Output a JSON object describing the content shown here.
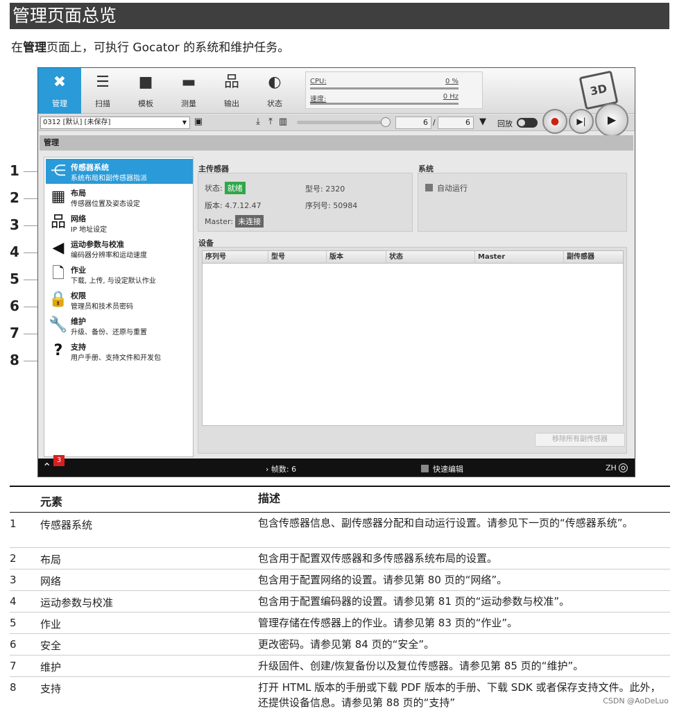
{
  "doc": {
    "title": "管理页面总览",
    "intro_pre": "在",
    "intro_bold": "管理",
    "intro_post": "页面上，可执行 Gocator 的系统和维护任务。"
  },
  "callouts": [
    "1",
    "2",
    "3",
    "4",
    "5",
    "6",
    "7",
    "8"
  ],
  "app": {
    "toolbar": [
      {
        "label": "管理",
        "icon": "tools-icon",
        "glyph": "✖"
      },
      {
        "label": "扫描",
        "icon": "scan-icon",
        "glyph": "☰"
      },
      {
        "label": "模板",
        "icon": "cubes-icon",
        "glyph": "■"
      },
      {
        "label": "测量",
        "icon": "ruler-icon",
        "glyph": "▬"
      },
      {
        "label": "输出",
        "icon": "network-icon",
        "glyph": "品"
      },
      {
        "label": "状态",
        "icon": "gauge-icon",
        "glyph": "◐"
      }
    ],
    "meters": {
      "cpu_label": "CPU:",
      "cpu_value": "0 %",
      "speed_label": "速度:",
      "speed_value": "0 Hz"
    },
    "job": "0312 [默认] [未保存]",
    "frame_current": "6",
    "frame_slash": "/",
    "frame_total": "6",
    "playback_label": "回放",
    "panel_title": "管理",
    "sidebar": [
      {
        "title": "传感器系统",
        "desc": "系统布局和副传感器指派",
        "icon": "share-icon",
        "glyph": "⋲",
        "active": true
      },
      {
        "title": "布局",
        "desc": "传感器位置及姿态设定",
        "icon": "layout-icon",
        "glyph": "▦"
      },
      {
        "title": "网络",
        "desc": "IP 地址设定",
        "icon": "network-icon",
        "glyph": "品"
      },
      {
        "title": "运动参数与校准",
        "desc": "编码器分辨率和运动速度",
        "icon": "plug-icon",
        "glyph": "◀"
      },
      {
        "title": "作业",
        "desc": "下载, 上传, 与设定默认作业",
        "icon": "document-icon",
        "glyph": "🗋"
      },
      {
        "title": "权限",
        "desc": "管理员和技术员密码",
        "icon": "lock-icon",
        "glyph": "🔒"
      },
      {
        "title": "维护",
        "desc": "升级、备份、还原与重置",
        "icon": "wrench-icon",
        "glyph": "🔧"
      },
      {
        "title": "支持",
        "desc": "用户手册、支持文件和开发包",
        "icon": "question-icon",
        "glyph": "?"
      }
    ],
    "main_sensor": {
      "section": "主传感器",
      "status_label": "状态:",
      "status_value": "就绪",
      "model_label": "型号: 2320",
      "version_label": "版本: 4.7.12.47",
      "serial_label": "序列号: 50984",
      "master_label": "Master:",
      "master_value": "未连接"
    },
    "system": {
      "section": "系统",
      "autorun": "自动运行"
    },
    "devices": {
      "section": "设备",
      "columns": [
        "序列号",
        "型号",
        "版本",
        "状态",
        "Master",
        "副传感器"
      ],
      "remove_button": "移除所有副传感器"
    },
    "statusbar": {
      "badge": "3",
      "frames": "› 帧数: 6",
      "quick_edit": "快速编辑",
      "lang": "ZH"
    }
  },
  "table": {
    "header": {
      "element": "元素",
      "description": "描述"
    },
    "rows": [
      {
        "num": "1",
        "element": "传感器系统",
        "description": "包含传感器信息、副传感器分配和自动运行设置。请参见下一页的“传感器系统”。"
      },
      {
        "num": "2",
        "element": "布局",
        "description": "包含用于配置双传感器和多传感器系统布局的设置。"
      },
      {
        "num": "3",
        "element": "网络",
        "description": "包含用于配置网络的设置。请参见第 80 页的“网络”。"
      },
      {
        "num": "4",
        "element": "运动参数与校准",
        "description": "包含用于配置编码器的设置。请参见第 81 页的“运动参数与校准”。"
      },
      {
        "num": "5",
        "element": "作业",
        "description": "管理存储在传感器上的作业。请参见第 83 页的“作业”。"
      },
      {
        "num": "6",
        "element": "安全",
        "description": "更改密码。请参见第 84 页的“安全”。"
      },
      {
        "num": "7",
        "element": "维护",
        "description": "升级固件、创建/恢复备份以及复位传感器。请参见第 85 页的“维护”。"
      },
      {
        "num": "8",
        "element": "支持",
        "description": "打开 HTML 版本的手册或下载 PDF 版本的手册、下载 SDK 或者保存支持文件。此外，还提供设备信息。请参见第 88 页的“支持”"
      }
    ]
  },
  "watermark": "CSDN @AoDeLuo"
}
